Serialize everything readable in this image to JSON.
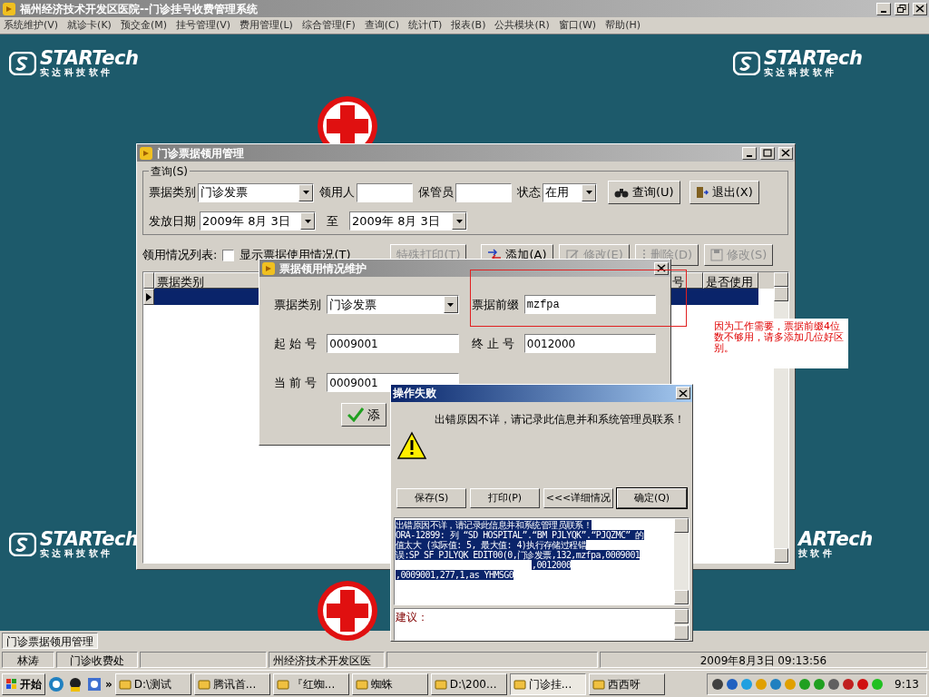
{
  "app_window": {
    "title": "福州经济技术开发区医院--门诊挂号收费管理系统"
  },
  "menu": [
    "系统维护(V)",
    "就诊卡(K)",
    "预交金(M)",
    "挂号管理(V)",
    "费用管理(L)",
    "综合管理(F)",
    "查询(C)",
    "统计(T)",
    "报表(B)",
    "公共模块(R)",
    "窗口(W)",
    "帮助(H)"
  ],
  "logos": [
    {
      "brand": "STARTech",
      "tagline": "实 达 科 技 软 件"
    },
    {
      "brand": "STARTech",
      "tagline": "实 达 科 技 软 件"
    },
    {
      "brand": "STARTech",
      "tagline": "实 达 科 技 软 件"
    },
    {
      "brand": "ARTech",
      "tagline": "技 软 件"
    }
  ],
  "main_window": {
    "title": "门诊票据领用管理",
    "query_group": "查询(S)",
    "fields": [
      {
        "label": "票据类别",
        "kind": "combo",
        "value": "门诊发票"
      },
      {
        "label": "领用人",
        "kind": "text"
      },
      {
        "label": "保管员",
        "kind": "text"
      },
      {
        "label": "状态",
        "kind": "combo",
        "value": "在用"
      }
    ],
    "query_button": "查询(U)",
    "exit_button": "退出(X)",
    "date_label": "发放日期",
    "date_from": "2009年  8月  3日",
    "date_to_label": "至",
    "date_to": "2009年  8月  3日",
    "list_label": "领用情况列表:",
    "show_usage": {
      "label": "显示票据使用情况(T)",
      "checked": false
    },
    "toolbar": [
      {
        "label": "特殊打印(T)",
        "disabled": true
      },
      {
        "label": "添加(A)",
        "disabled": false
      },
      {
        "label": "修改(E)",
        "disabled": true
      },
      {
        "label": "删除(D)",
        "disabled": true
      },
      {
        "label": "修改(S)",
        "disabled": true
      }
    ],
    "table": {
      "columns": [
        "票据类别",
        "号",
        "是否使用"
      ],
      "rows": [
        {
          "selected": true
        }
      ]
    }
  },
  "edit_dialog": {
    "title": "票据领用情况维护",
    "fields": [
      {
        "label": "票据类别",
        "kind": "combo",
        "value": "门诊发票"
      },
      {
        "label": "票据前缀",
        "kind": "text",
        "value": "mzfpa"
      },
      {
        "label": "起 始 号",
        "kind": "text",
        "value": "0009001"
      },
      {
        "label": "终 止 号",
        "kind": "text",
        "value": "0012000"
      },
      {
        "label": "当 前 号",
        "kind": "text",
        "value": "0009001"
      }
    ],
    "add_button": "添"
  },
  "error_dialog": {
    "title": "操作失败",
    "message": "出错原因不详，请记录此信息并和系统管理员联系！",
    "buttons": [
      "保存(S)",
      "打印(P)",
      "<<<详细情况",
      "确定(Q)"
    ],
    "details": [
      "出错原因不详，请记录此信息并和系统管理员联系！",
      "ORA-12899: 列 “SD_HOSPITAL”.“BM_PJLYQK”.“PJQZMC” 的",
      "值太大 (实际值: 5, 最大值: 4)执行存储过程错",
      "误:SP_SF_PJLYQK_EDIT00(0,门诊发票,132,mzfpa,0009001",
      ",0012000",
      ",0009001,277,1,as_YHMSG0"
    ],
    "suggestion_label": "建议："
  },
  "annotation": {
    "note": "因为工作需要，票据前缀4位数不够用，请多添加几位好区别。"
  },
  "window_tabs": [
    {
      "label": "门诊票据领用管理",
      "selected": true
    }
  ],
  "status_bar": [
    "林涛",
    "门诊收费处",
    "州经济技术开发区医",
    "2009年8月3日  09:13:56"
  ],
  "taskbar": {
    "start": "开始",
    "more": "»",
    "items": [
      {
        "label": "D:\\测试",
        "selected": false
      },
      {
        "label": "腾讯首...",
        "selected": false
      },
      {
        "label": "『红蜘...",
        "selected": false
      },
      {
        "label": "蜘蛛",
        "selected": false
      },
      {
        "label": "D:\\200...",
        "selected": false
      },
      {
        "label": "门诊挂...",
        "selected": true
      },
      {
        "label": "西西呀",
        "selected": false
      }
    ],
    "clock": "9:13"
  }
}
